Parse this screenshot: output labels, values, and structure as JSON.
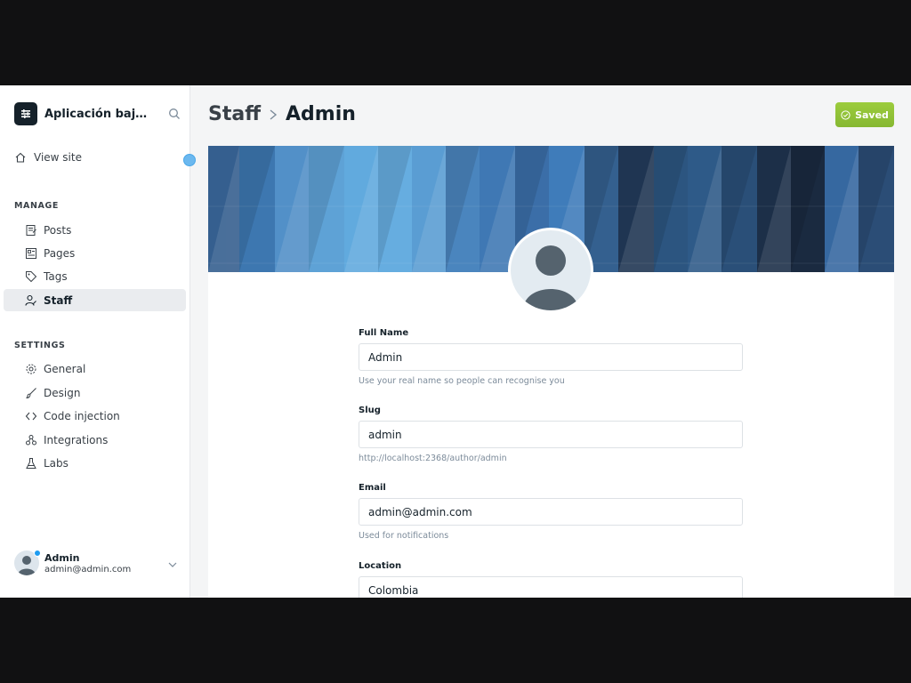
{
  "sidebar": {
    "brand_name": "Aplicación bajo pr...",
    "view_site": "View site",
    "manage_title": "MANAGE",
    "manage_items": [
      {
        "label": "Posts",
        "icon": "posts-icon"
      },
      {
        "label": "Pages",
        "icon": "pages-icon"
      },
      {
        "label": "Tags",
        "icon": "tag-icon"
      },
      {
        "label": "Staff",
        "icon": "staff-icon",
        "active": true
      }
    ],
    "settings_title": "SETTINGS",
    "settings_items": [
      {
        "label": "General",
        "icon": "gear-icon"
      },
      {
        "label": "Design",
        "icon": "brush-icon"
      },
      {
        "label": "Code injection",
        "icon": "code-icon"
      },
      {
        "label": "Integrations",
        "icon": "integrations-icon"
      },
      {
        "label": "Labs",
        "icon": "flask-icon"
      }
    ],
    "user": {
      "name": "Admin",
      "email": "admin@admin.com"
    }
  },
  "header": {
    "breadcrumb_parent": "Staff",
    "breadcrumb_current": "Admin",
    "saved_label": "Saved"
  },
  "form": {
    "full_name": {
      "label": "Full Name",
      "value": "Admin",
      "hint": "Use your real name so people can recognise you"
    },
    "slug": {
      "label": "Slug",
      "value": "admin",
      "hint": "http://localhost:2368/author/admin"
    },
    "email": {
      "label": "Email",
      "value": "admin@admin.com",
      "hint": "Used for notifications"
    },
    "location": {
      "label": "Location",
      "value": "Colombia"
    }
  },
  "colors": {
    "accent_green": "#8bc34a",
    "sidebar_active": "#eaecef",
    "notify_blue": "#6bb8ef"
  }
}
